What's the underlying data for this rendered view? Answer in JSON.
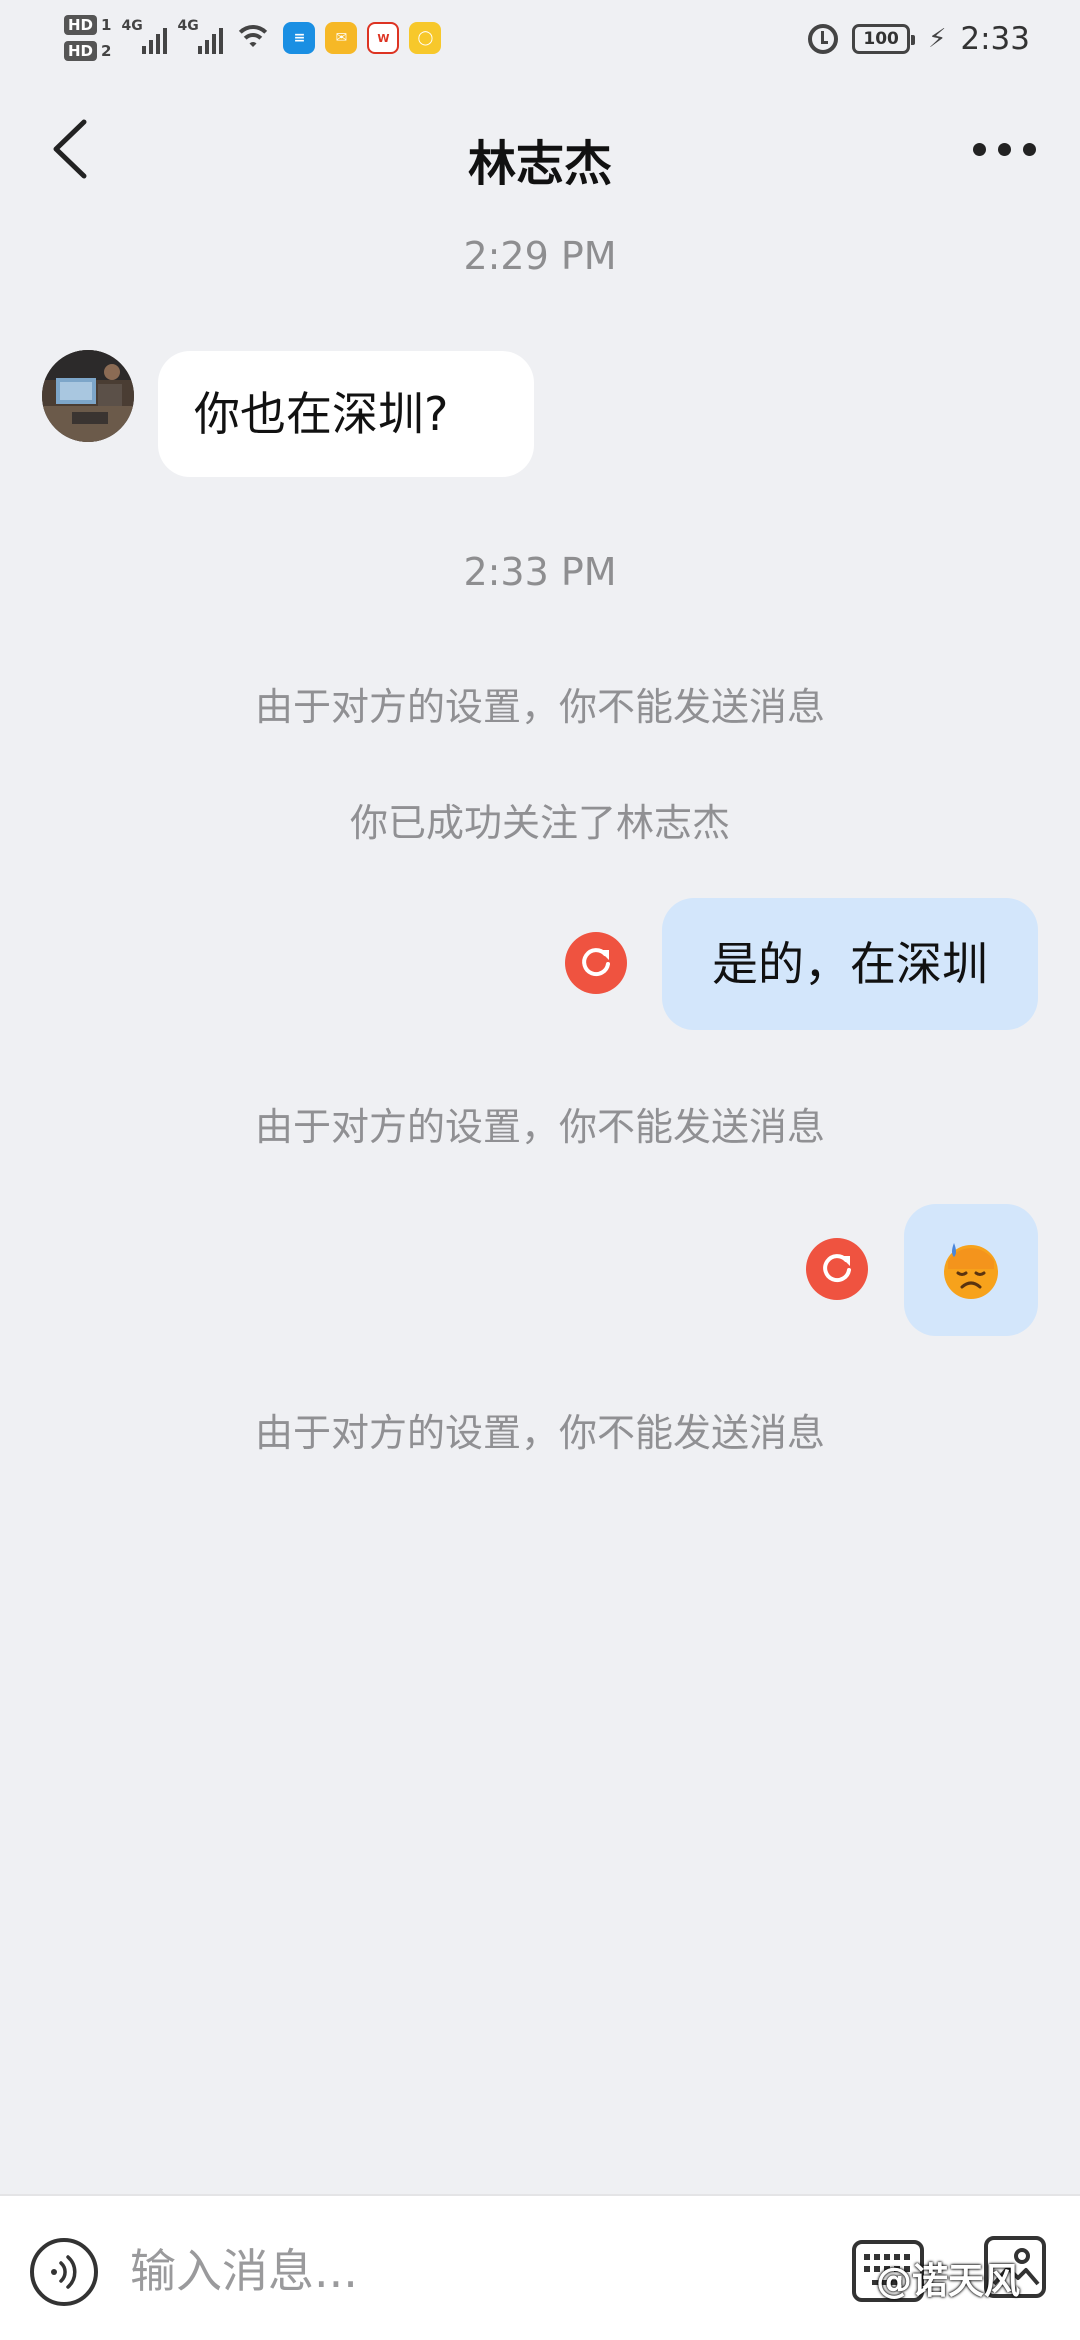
{
  "status_bar": {
    "time": "2:33",
    "battery": "100",
    "sim1_label": "HD",
    "sim1_num": "1",
    "sim2_label": "HD",
    "sim2_num": "2",
    "network1": "4G",
    "network2": "4G",
    "app_icons": [
      "chat-app-icon",
      "mail-icon",
      "weibo-icon",
      "yellow-app-icon"
    ]
  },
  "header": {
    "title": "林志杰"
  },
  "messages": {
    "timestamp1": "2:29 PM",
    "incoming1": "你也在深圳?",
    "timestamp2": "2:33 PM",
    "notice1": "由于对方的设置，你不能发送消息",
    "notice_follow": "你已成功关注了林志杰",
    "outgoing1": "是的，在深圳",
    "notice2": "由于对方的设置，你不能发送消息",
    "outgoing2_emoji": "disappointed-sweat-emoji",
    "notice3": "由于对方的设置，你不能发送消息"
  },
  "input_bar": {
    "placeholder": "输入消息...",
    "value": "",
    "watermark": "@诺天风"
  },
  "colors": {
    "background": "#eff0f3",
    "outgoing_bubble": "#d3e6fb",
    "incoming_bubble": "#ffffff",
    "retry_red": "#ef5340",
    "notice_gray": "#909093"
  }
}
